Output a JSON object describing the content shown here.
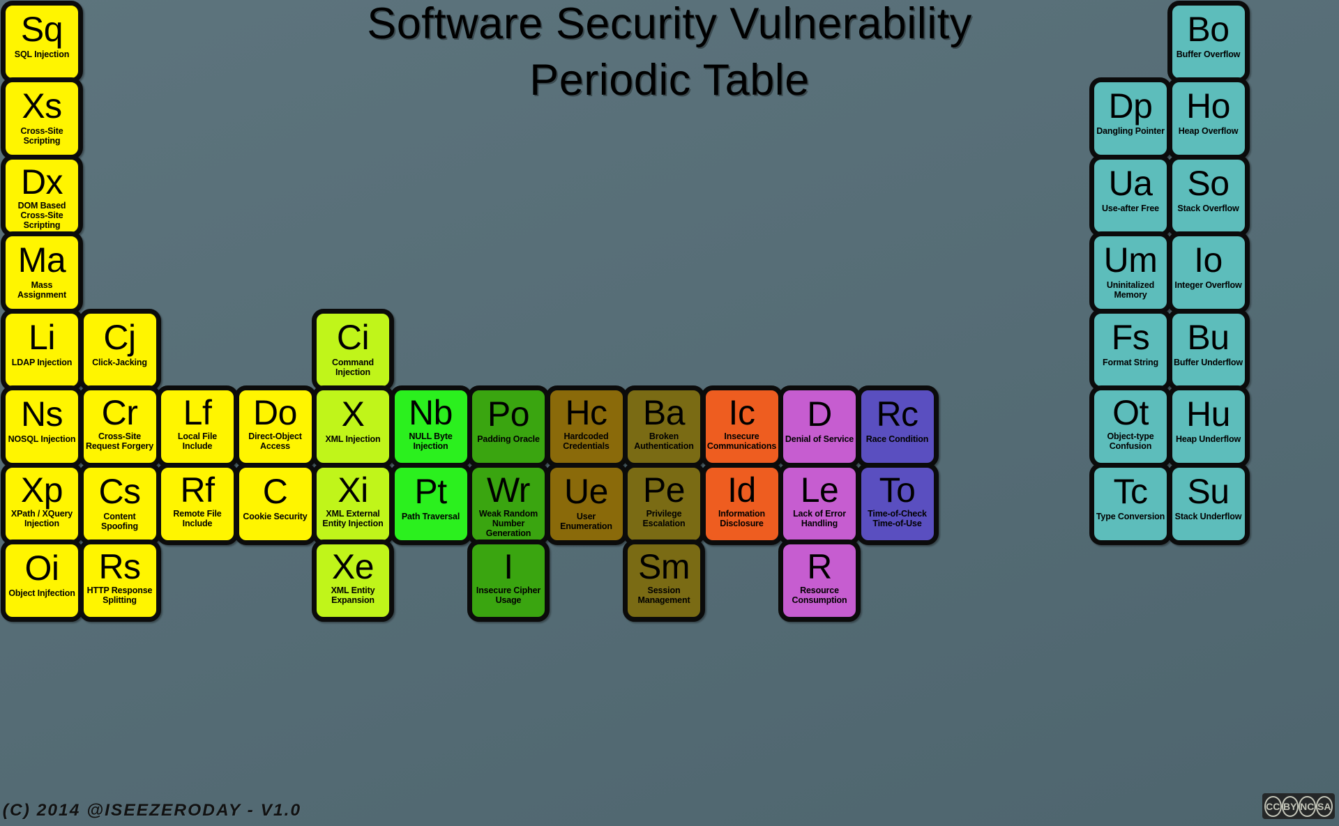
{
  "title": {
    "line1": "Software Security Vulnerability",
    "line2": "Periodic Table"
  },
  "footer": {
    "credit": "(C) 2014 @ISEEZERODAY - V1.0",
    "license_badge": "cc-by-nc-sa-badge",
    "license_glyphs": [
      "CC",
      "BY",
      "NC",
      "SA"
    ]
  },
  "colors": {
    "background": "#5a7079",
    "injection_yellow": "#FFF500",
    "injection_lime": "#C0F51A",
    "injection_green": "#2BF01E",
    "logic_green": "#3AA510",
    "config_gold": "#8A6A0A",
    "config_olive": "#7A6B14",
    "crypto_orange": "#EE5D20",
    "availability_magenta": "#C65DD0",
    "concurrency_indigo": "#5A4FC0",
    "memory_teal": "#5DBDBB",
    "outline": "#0b0b0b"
  },
  "elements": [
    {
      "sym": "Sq",
      "name": "SQL Injection",
      "col": 1,
      "row": 1,
      "color": "#FFF500"
    },
    {
      "sym": "Bo",
      "name": "Buffer Overflow",
      "col": 16,
      "row": 1,
      "color": "#5DBDBB"
    },
    {
      "sym": "Xs",
      "name": "Cross-Site Scripting",
      "col": 1,
      "row": 2,
      "color": "#FFF500"
    },
    {
      "sym": "Dp",
      "name": "Dangling Pointer",
      "col": 15,
      "row": 2,
      "color": "#5DBDBB"
    },
    {
      "sym": "Ho",
      "name": "Heap Overflow",
      "col": 16,
      "row": 2,
      "color": "#5DBDBB"
    },
    {
      "sym": "Dx",
      "name": "DOM Based\nCross-Site Scripting",
      "col": 1,
      "row": 3,
      "color": "#FFF500"
    },
    {
      "sym": "Ua",
      "name": "Use-after Free",
      "col": 15,
      "row": 3,
      "color": "#5DBDBB"
    },
    {
      "sym": "So",
      "name": "Stack Overflow",
      "col": 16,
      "row": 3,
      "color": "#5DBDBB"
    },
    {
      "sym": "Ma",
      "name": "Mass Assignment",
      "col": 1,
      "row": 4,
      "color": "#FFF500"
    },
    {
      "sym": "Um",
      "name": "Uninitalized Memory",
      "col": 15,
      "row": 4,
      "color": "#5DBDBB"
    },
    {
      "sym": "Io",
      "name": "Integer Overflow",
      "col": 16,
      "row": 4,
      "color": "#5DBDBB"
    },
    {
      "sym": "Li",
      "name": "LDAP Injection",
      "col": 1,
      "row": 5,
      "color": "#FFF500"
    },
    {
      "sym": "Cj",
      "name": "Click-Jacking",
      "col": 2,
      "row": 5,
      "color": "#FFF500"
    },
    {
      "sym": "Ci",
      "name": "Command Injection",
      "col": 5,
      "row": 5,
      "color": "#C0F51A"
    },
    {
      "sym": "Fs",
      "name": "Format String",
      "col": 15,
      "row": 5,
      "color": "#5DBDBB"
    },
    {
      "sym": "Bu",
      "name": "Buffer Underflow",
      "col": 16,
      "row": 5,
      "color": "#5DBDBB"
    },
    {
      "sym": "Ns",
      "name": "NOSQL Injection",
      "col": 1,
      "row": 6,
      "color": "#FFF500"
    },
    {
      "sym": "Cr",
      "name": "Cross-Site\nRequest Forgery",
      "col": 2,
      "row": 6,
      "color": "#FFF500"
    },
    {
      "sym": "Lf",
      "name": "Local File\nInclude",
      "col": 3,
      "row": 6,
      "color": "#FFF500"
    },
    {
      "sym": "Do",
      "name": "Direct-Object\nAccess",
      "col": 4,
      "row": 6,
      "color": "#FFF500"
    },
    {
      "sym": "X",
      "name": "XML Injection",
      "col": 5,
      "row": 6,
      "color": "#C0F51A"
    },
    {
      "sym": "Nb",
      "name": "NULL Byte\nInjection",
      "col": 6,
      "row": 6,
      "color": "#2BF01E"
    },
    {
      "sym": "Po",
      "name": "Padding Oracle",
      "col": 7,
      "row": 6,
      "color": "#3AA510"
    },
    {
      "sym": "Hc",
      "name": "Hardcoded\nCredentials",
      "col": 8,
      "row": 6,
      "color": "#8A6A0A"
    },
    {
      "sym": "Ba",
      "name": "Broken\nAuthentication",
      "col": 9,
      "row": 6,
      "color": "#7A6B14"
    },
    {
      "sym": "Ic",
      "name": "Insecure\nCommunications",
      "col": 10,
      "row": 6,
      "color": "#EE5D20"
    },
    {
      "sym": "D",
      "name": "Denial of Service",
      "col": 11,
      "row": 6,
      "color": "#C65DD0"
    },
    {
      "sym": "Rc",
      "name": "Race Condition",
      "col": 12,
      "row": 6,
      "color": "#5A4FC0"
    },
    {
      "sym": "Ot",
      "name": "Object-type\nConfusion",
      "col": 15,
      "row": 6,
      "color": "#5DBDBB"
    },
    {
      "sym": "Hu",
      "name": "Heap Underflow",
      "col": 16,
      "row": 6,
      "color": "#5DBDBB"
    },
    {
      "sym": "Xp",
      "name": "XPath / XQuery\nInjection",
      "col": 1,
      "row": 7,
      "color": "#FFF500"
    },
    {
      "sym": "Cs",
      "name": "Content Spoofing",
      "col": 2,
      "row": 7,
      "color": "#FFF500"
    },
    {
      "sym": "Rf",
      "name": "Remote File\nInclude",
      "col": 3,
      "row": 7,
      "color": "#FFF500"
    },
    {
      "sym": "C",
      "name": "Cookie Security",
      "col": 4,
      "row": 7,
      "color": "#FFF500"
    },
    {
      "sym": "Xi",
      "name": "XML External\nEntity Injection",
      "col": 5,
      "row": 7,
      "color": "#C0F51A"
    },
    {
      "sym": "Pt",
      "name": "Path Traversal",
      "col": 6,
      "row": 7,
      "color": "#2BF01E"
    },
    {
      "sym": "Wr",
      "name": "Weak Random\nNumber Generation",
      "col": 7,
      "row": 7,
      "color": "#3AA510"
    },
    {
      "sym": "Ue",
      "name": "User Enumeration",
      "col": 8,
      "row": 7,
      "color": "#8A6A0A"
    },
    {
      "sym": "Pe",
      "name": "Privilege\nEscalation",
      "col": 9,
      "row": 7,
      "color": "#7A6B14"
    },
    {
      "sym": "Id",
      "name": "Information\nDisclosure",
      "col": 10,
      "row": 7,
      "color": "#EE5D20"
    },
    {
      "sym": "Le",
      "name": "Lack of Error\nHandling",
      "col": 11,
      "row": 7,
      "color": "#C65DD0"
    },
    {
      "sym": "To",
      "name": "Time-of-Check\nTime-of-Use",
      "col": 12,
      "row": 7,
      "color": "#5A4FC0"
    },
    {
      "sym": "Tc",
      "name": "Type Conversion",
      "col": 15,
      "row": 7,
      "color": "#5DBDBB"
    },
    {
      "sym": "Su",
      "name": "Stack Underflow",
      "col": 16,
      "row": 7,
      "color": "#5DBDBB"
    },
    {
      "sym": "Oi",
      "name": "Object Injfection",
      "col": 1,
      "row": 8,
      "color": "#FFF500"
    },
    {
      "sym": "Rs",
      "name": "HTTP Response\nSplitting",
      "col": 2,
      "row": 8,
      "color": "#FFF500"
    },
    {
      "sym": "Xe",
      "name": "XML Entity\nExpansion",
      "col": 5,
      "row": 8,
      "color": "#C0F51A"
    },
    {
      "sym": "I",
      "name": "Insecure Cipher\nUsage",
      "col": 7,
      "row": 8,
      "color": "#3AA510"
    },
    {
      "sym": "Sm",
      "name": "Session\nManagement",
      "col": 9,
      "row": 8,
      "color": "#7A6B14"
    },
    {
      "sym": "R",
      "name": "Resource\nConsumption",
      "col": 11,
      "row": 8,
      "color": "#C65DD0"
    }
  ]
}
